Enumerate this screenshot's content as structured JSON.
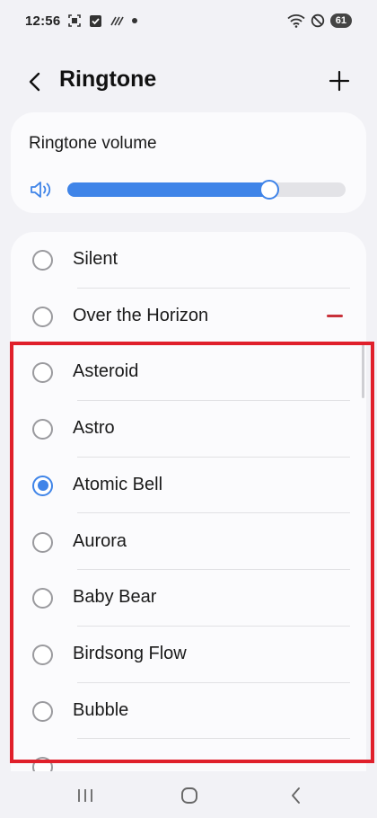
{
  "status_bar": {
    "time": "12:56",
    "battery": "61",
    "icons": [
      "screenshot-icon",
      "check-box-icon",
      "signal-lines-icon",
      "dot-icon",
      "wifi-icon",
      "do-not-disturb-icon"
    ]
  },
  "header": {
    "title": "Ringtone",
    "back_icon": "chevron-left-icon",
    "add_icon": "plus-icon"
  },
  "volume": {
    "title": "Ringtone volume",
    "level": 0.725,
    "accent": "#3f84e8"
  },
  "ringtones": [
    {
      "label": "Silent",
      "selected": false,
      "deletable": false
    },
    {
      "label": "Over the Horizon",
      "selected": false,
      "deletable": true
    },
    {
      "label": "Asteroid",
      "selected": false,
      "deletable": false
    },
    {
      "label": "Astro",
      "selected": false,
      "deletable": false
    },
    {
      "label": "Atomic Bell",
      "selected": true,
      "deletable": false
    },
    {
      "label": "Aurora",
      "selected": false,
      "deletable": false
    },
    {
      "label": "Baby Bear",
      "selected": false,
      "deletable": false
    },
    {
      "label": "Birdsong Flow",
      "selected": false,
      "deletable": false
    },
    {
      "label": "Bubble",
      "selected": false,
      "deletable": false
    },
    {
      "label": "",
      "selected": false,
      "deletable": false
    }
  ],
  "highlight_color": "#e0202b",
  "nav_bar": {
    "icons": [
      "recents-icon",
      "home-icon",
      "back-icon"
    ]
  }
}
